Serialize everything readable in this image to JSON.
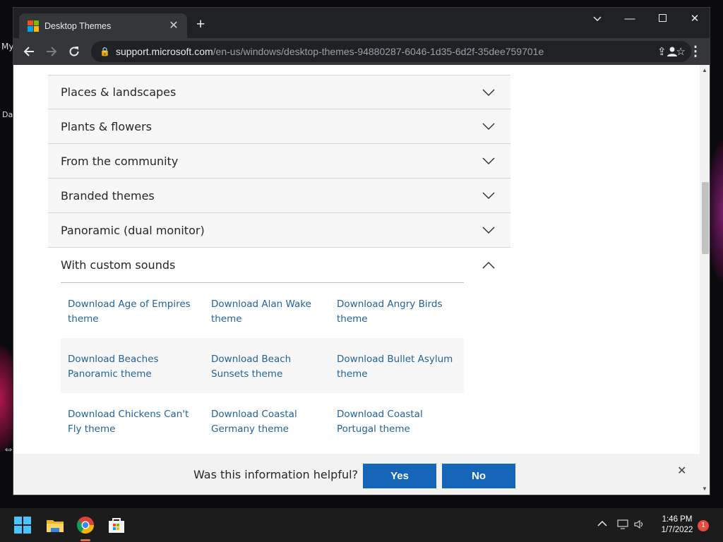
{
  "desktop": {
    "icon_label_1": "My",
    "icon_label_2": "Da"
  },
  "browser": {
    "tab_title": "Desktop Themes",
    "url_host": "support.microsoft.com",
    "url_path": "/en-us/windows/desktop-themes-94880287-6046-1d35-6d2f-35dee759701e"
  },
  "accordion": {
    "items": [
      {
        "label": "Places & landscapes"
      },
      {
        "label": "Plants & flowers"
      },
      {
        "label": "From the community"
      },
      {
        "label": "Branded themes"
      },
      {
        "label": "Panoramic (dual monitor)"
      },
      {
        "label": "With custom sounds"
      }
    ],
    "links": [
      [
        "Download Age of Empires theme",
        "Download Alan Wake theme",
        "Download Angry Birds theme"
      ],
      [
        "Download Beaches Panoramic theme",
        "Download Beach Sunsets theme",
        "Download Bullet Asylum theme"
      ],
      [
        "Download Chickens Can't Fly theme",
        "Download Coastal Germany theme",
        "Download Coastal Portugal theme"
      ]
    ]
  },
  "feedback": {
    "question": "Was this information helpful?",
    "yes": "Yes",
    "no": "No"
  },
  "taskbar": {
    "time": "1:46 PM",
    "date": "1/7/2022",
    "notification_count": "1"
  },
  "colors": {
    "link": "#22639a",
    "button": "#1565b8"
  }
}
